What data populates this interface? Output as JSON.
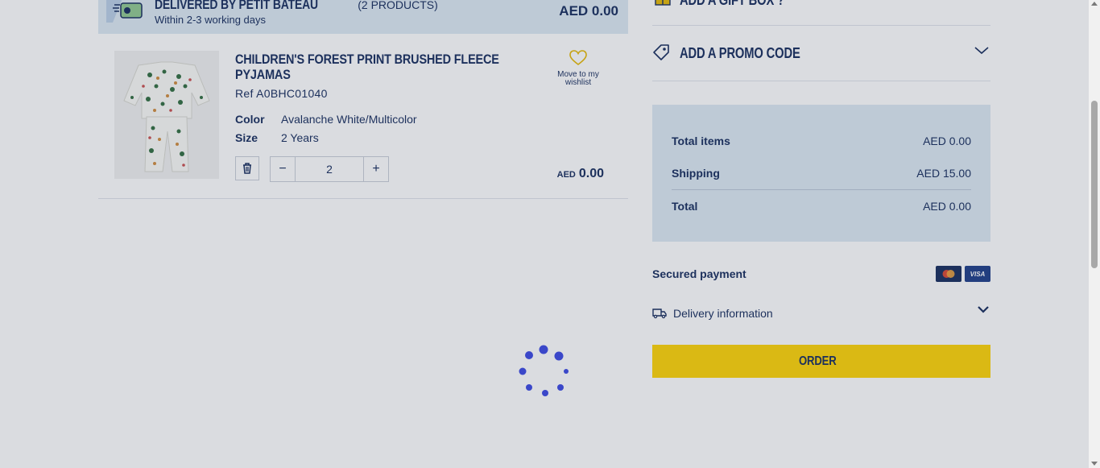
{
  "delivery": {
    "title": "DELIVERED BY PETIT BATEAU",
    "count": "(2 PRODUCTS)",
    "subtitle": "Within 2-3 working days",
    "total": "AED 0.00",
    "icon": "delivery-truck-icon"
  },
  "product": {
    "name": "CHILDREN'S FOREST PRINT BRUSHED FLEECE PYJAMAS",
    "ref": "Ref A0BHC01040",
    "color_label": "Color",
    "color_value": "Avalanche White/Multicolor",
    "size_label": "Size",
    "size_value": "2 Years",
    "quantity": "2",
    "qty_minus": "−",
    "qty_plus": "+",
    "wishlist_label": "Move to my wishlist",
    "price_currency": "AED",
    "price_amount": "0.00"
  },
  "sidebar": {
    "gift_box_label": "ADD A GIFT BOX ?",
    "promo_label": "ADD A PROMO CODE",
    "summary": {
      "items_label": "Total items",
      "items_value": "AED 0.00",
      "shipping_label": "Shipping",
      "shipping_value": "AED 15.00",
      "total_label": "Total",
      "total_value": "AED 0.00"
    },
    "secured_payment_label": "Secured payment",
    "visa_label": "VISA",
    "delivery_info_label": "Delivery information",
    "order_label": "ORDER"
  },
  "colors": {
    "navy": "#12285a",
    "panel": "#dce9f3",
    "order_button": "#ffd400",
    "spinner": "#3a47c9"
  },
  "loading": true
}
